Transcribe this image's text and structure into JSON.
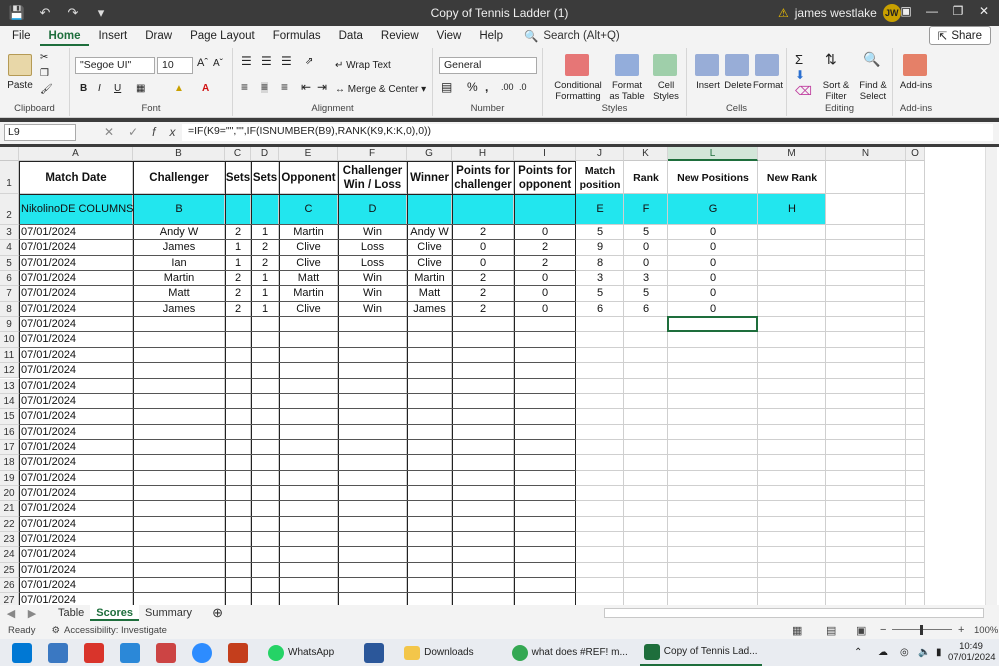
{
  "window": {
    "title": "Copy of Tennis Ladder (1)",
    "user_name": "james westlake",
    "user_initials": "JW"
  },
  "menu": {
    "items": [
      "File",
      "Home",
      "Insert",
      "Draw",
      "Page Layout",
      "Formulas",
      "Data",
      "Review",
      "View",
      "Help"
    ],
    "active": "Home",
    "search_placeholder": "Search (Alt+Q)",
    "share_label": "Share"
  },
  "ribbon": {
    "clipboard": {
      "paste": "Paste",
      "label": "Clipboard"
    },
    "font": {
      "name": "\"Segoe UI\"",
      "size": "10",
      "label": "Font"
    },
    "alignment": {
      "wrap": "Wrap Text",
      "merge": "Merge & Center",
      "label": "Alignment"
    },
    "number": {
      "format": "General",
      "label": "Number"
    },
    "styles": {
      "conditional": "Conditional Formatting",
      "table": "Format as Table",
      "cell": "Cell Styles",
      "label": "Styles"
    },
    "cells": {
      "insert": "Insert",
      "delete": "Delete",
      "format": "Format",
      "label": "Cells"
    },
    "editing": {
      "sort": "Sort & Filter",
      "find": "Find & Select",
      "label": "Editing"
    },
    "addins": {
      "btn": "Add-ins",
      "label": "Add-ins"
    }
  },
  "formula_bar": {
    "name_box": "L9",
    "formula": "=IF(K9=\"\",\"\",IF(ISNUMBER(B9),RANK(K9,K:K,0),0))"
  },
  "columns": [
    "A",
    "B",
    "C",
    "D",
    "E",
    "F",
    "G",
    "H",
    "I",
    "J",
    "K",
    "L",
    "M",
    "N",
    "O"
  ],
  "selected_column": "L",
  "headers": {
    "A": "Match Date",
    "B": "Challenger",
    "C": "Sets",
    "D": "Sets",
    "E": "Opponent",
    "F": "Challenger Win / Loss",
    "G": "Winner",
    "H": "Points for challenger",
    "I": "Points for opponent",
    "J": "Match position",
    "K": "Rank",
    "L": "New Positions",
    "M": "New Rank"
  },
  "code_row": {
    "A": "NikolinoDE COLUMNS",
    "B": "B",
    "E": "C",
    "F": "D",
    "J": "E",
    "K": "F",
    "L": "G",
    "M": "H"
  },
  "rows": [
    {
      "n": "3",
      "A": "07/01/2024",
      "B": "Andy W",
      "C": "2",
      "D": "1",
      "E": "Martin",
      "F": "Win",
      "G": "Andy W",
      "H": "2",
      "I": "0",
      "J": "5",
      "K": "5",
      "L": "0"
    },
    {
      "n": "4",
      "A": "07/01/2024",
      "B": "James",
      "C": "1",
      "D": "2",
      "E": "Clive",
      "F": "Loss",
      "G": "Clive",
      "H": "0",
      "I": "2",
      "J": "9",
      "K": "0",
      "L": "0"
    },
    {
      "n": "5",
      "A": "07/01/2024",
      "B": "Ian",
      "C": "1",
      "D": "2",
      "E": "Clive",
      "F": "Loss",
      "G": "Clive",
      "H": "0",
      "I": "2",
      "J": "8",
      "K": "0",
      "L": "0"
    },
    {
      "n": "6",
      "A": "07/01/2024",
      "B": "Martin",
      "C": "2",
      "D": "1",
      "E": "Matt",
      "F": "Win",
      "G": "Martin",
      "H": "2",
      "I": "0",
      "J": "3",
      "K": "3",
      "L": "0"
    },
    {
      "n": "7",
      "A": "07/01/2024",
      "B": "Matt",
      "C": "2",
      "D": "1",
      "E": "Martin",
      "F": "Win",
      "G": "Matt",
      "H": "2",
      "I": "0",
      "J": "5",
      "K": "5",
      "L": "0"
    },
    {
      "n": "8",
      "A": "07/01/2024",
      "B": "James",
      "C": "2",
      "D": "1",
      "E": "Clive",
      "F": "Win",
      "G": "James",
      "H": "2",
      "I": "0",
      "J": "6",
      "K": "6",
      "L": "0"
    },
    {
      "n": "9",
      "A": "07/01/2024"
    },
    {
      "n": "10",
      "A": "07/01/2024"
    },
    {
      "n": "11",
      "A": "07/01/2024"
    },
    {
      "n": "12",
      "A": "07/01/2024"
    },
    {
      "n": "13",
      "A": "07/01/2024"
    },
    {
      "n": "14",
      "A": "07/01/2024"
    },
    {
      "n": "15",
      "A": "07/01/2024"
    },
    {
      "n": "16",
      "A": "07/01/2024"
    },
    {
      "n": "17",
      "A": "07/01/2024"
    },
    {
      "n": "18",
      "A": "07/01/2024"
    },
    {
      "n": "19",
      "A": "07/01/2024"
    },
    {
      "n": "20",
      "A": "07/01/2024"
    },
    {
      "n": "21",
      "A": "07/01/2024"
    },
    {
      "n": "22",
      "A": "07/01/2024"
    },
    {
      "n": "23",
      "A": "07/01/2024"
    },
    {
      "n": "24",
      "A": "07/01/2024"
    },
    {
      "n": "25",
      "A": "07/01/2024"
    },
    {
      "n": "26",
      "A": "07/01/2024"
    },
    {
      "n": "27",
      "A": "07/01/2024"
    }
  ],
  "sheets": [
    "Table",
    "Scores",
    "Summary"
  ],
  "active_sheet": "Scores",
  "status": {
    "ready": "Ready",
    "accessibility": "Accessibility: Investigate",
    "zoom": "100%"
  },
  "taskbar": {
    "whatsapp": "WhatsApp",
    "downloads": "Downloads",
    "chrome": "what does #REF! m...",
    "excel": "Copy of Tennis Lad...",
    "time": "10:49",
    "date": "07/01/2024"
  },
  "colors": {
    "accent": "#1e6e3c",
    "cyan_fill": "#22e6ee"
  }
}
